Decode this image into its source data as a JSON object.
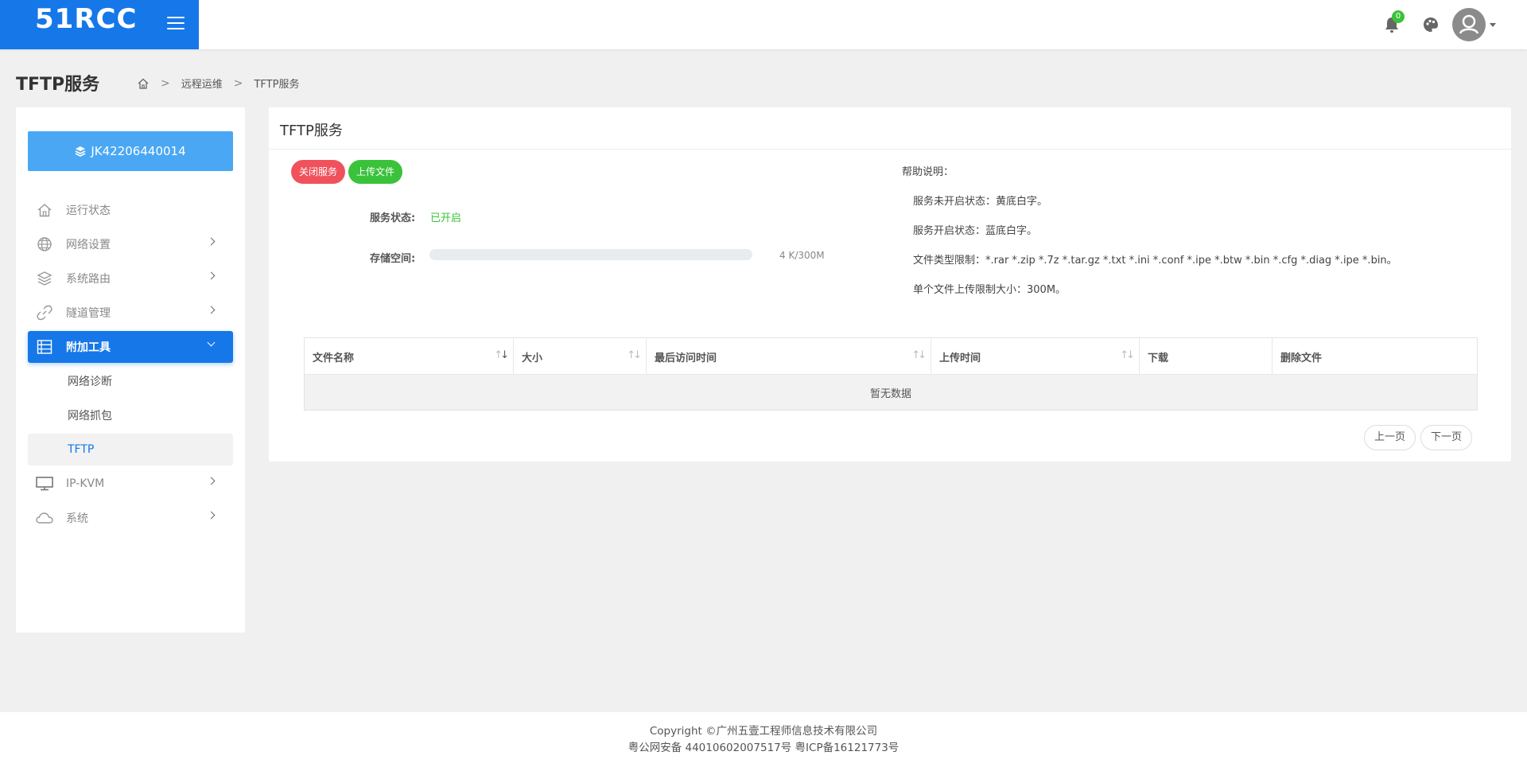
{
  "header": {
    "logo": "51RCC",
    "notifications_count": "0"
  },
  "page": {
    "title": "TFTP服务",
    "breadcrumb": [
      "远程运维",
      "TFTP服务"
    ]
  },
  "sidebar": {
    "device_id": "JK42206440014",
    "items": [
      {
        "label": "运行状态",
        "icon": "home-icon"
      },
      {
        "label": "网络设置",
        "icon": "globe-icon"
      },
      {
        "label": "系统路由",
        "icon": "layers-icon"
      },
      {
        "label": "隧道管理",
        "icon": "link-icon"
      },
      {
        "label": "附加工具",
        "icon": "tools-icon",
        "active": true
      },
      {
        "label": "IP-KVM",
        "icon": "monitor-icon"
      },
      {
        "label": "系统",
        "icon": "cloud-icon"
      }
    ],
    "submenu": [
      {
        "label": "网络诊断"
      },
      {
        "label": "网络抓包"
      },
      {
        "label": "TFTP",
        "current": true
      }
    ],
    "active_color": "#1677e8"
  },
  "card": {
    "title": "TFTP服务",
    "buttons": {
      "close_service": "关闭服务",
      "upload_file": "上传文件"
    },
    "service_status_label": "服务状态:",
    "service_status_value": "已开启",
    "storage_label": "存储空间:",
    "storage_value": "4 K/300M",
    "storage_used_fraction": 0.0,
    "help": {
      "title": "帮助说明：",
      "lines": [
        "服务未开启状态：黄底白字。",
        "服务开启状态：蓝底白字。",
        "文件类型限制：*.rar *.zip *.7z *.tar.gz *.txt *.ini *.conf *.ipe *.btw *.bin *.cfg *.diag *.ipe *.bin。",
        "单个文件上传限制大小：300M。"
      ]
    }
  },
  "table": {
    "columns": [
      "文件名称",
      "大小",
      "最后访问时间",
      "上传时间",
      "下载",
      "删除文件"
    ],
    "empty_text": "暂无数据"
  },
  "pager": {
    "prev": "上一页",
    "next": "下一页"
  },
  "footer": {
    "copyright": "Copyright ©广州五壹工程师信息技术有限公司",
    "icp": "粤公网安备 44010602007517号 粤ICP备16121773号"
  }
}
